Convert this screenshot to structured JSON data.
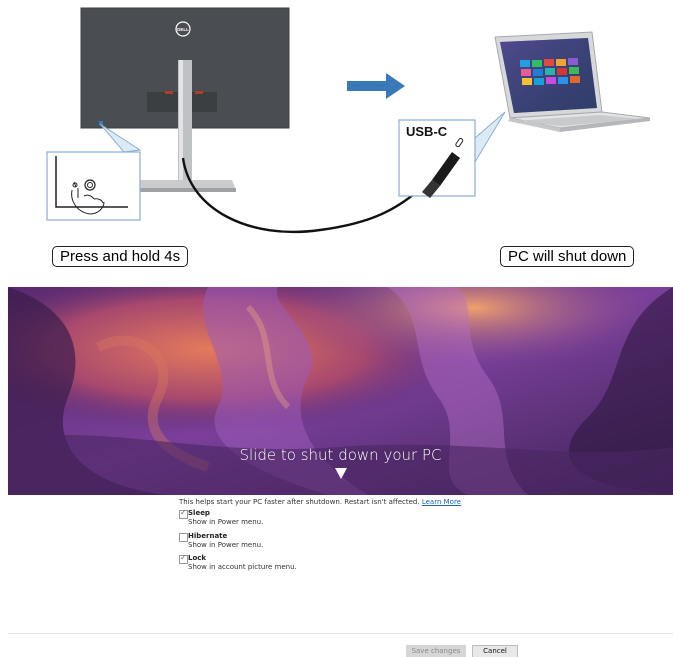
{
  "illustration": {
    "monitor_brand_logo": "DELL",
    "usb_label": "USB-C",
    "press_label": "Press and hold 4s",
    "result_label": "PC will shut down",
    "icons": [
      "monitor-rear",
      "power-button-finger",
      "arrow-right",
      "laptop",
      "usb-c-plug",
      "cable"
    ]
  },
  "screen": {
    "slide_text": "Slide to shut down your PC",
    "settings": {
      "fast_startup_desc": "This helps start your PC faster after shutdown. Restart isn't affected.",
      "learn_more": "Learn More",
      "options": [
        {
          "label": "Sleep",
          "desc": "Show in Power menu.",
          "checked": true
        },
        {
          "label": "Hibernate",
          "desc": "Show in Power menu.",
          "checked": false
        },
        {
          "label": "Lock",
          "desc": "Show in account picture menu.",
          "checked": true
        }
      ],
      "save_button": "Save changes",
      "cancel_button": "Cancel"
    }
  },
  "colors": {
    "arrow_blue": "#3a78b8",
    "link_blue": "#1a67b8"
  }
}
